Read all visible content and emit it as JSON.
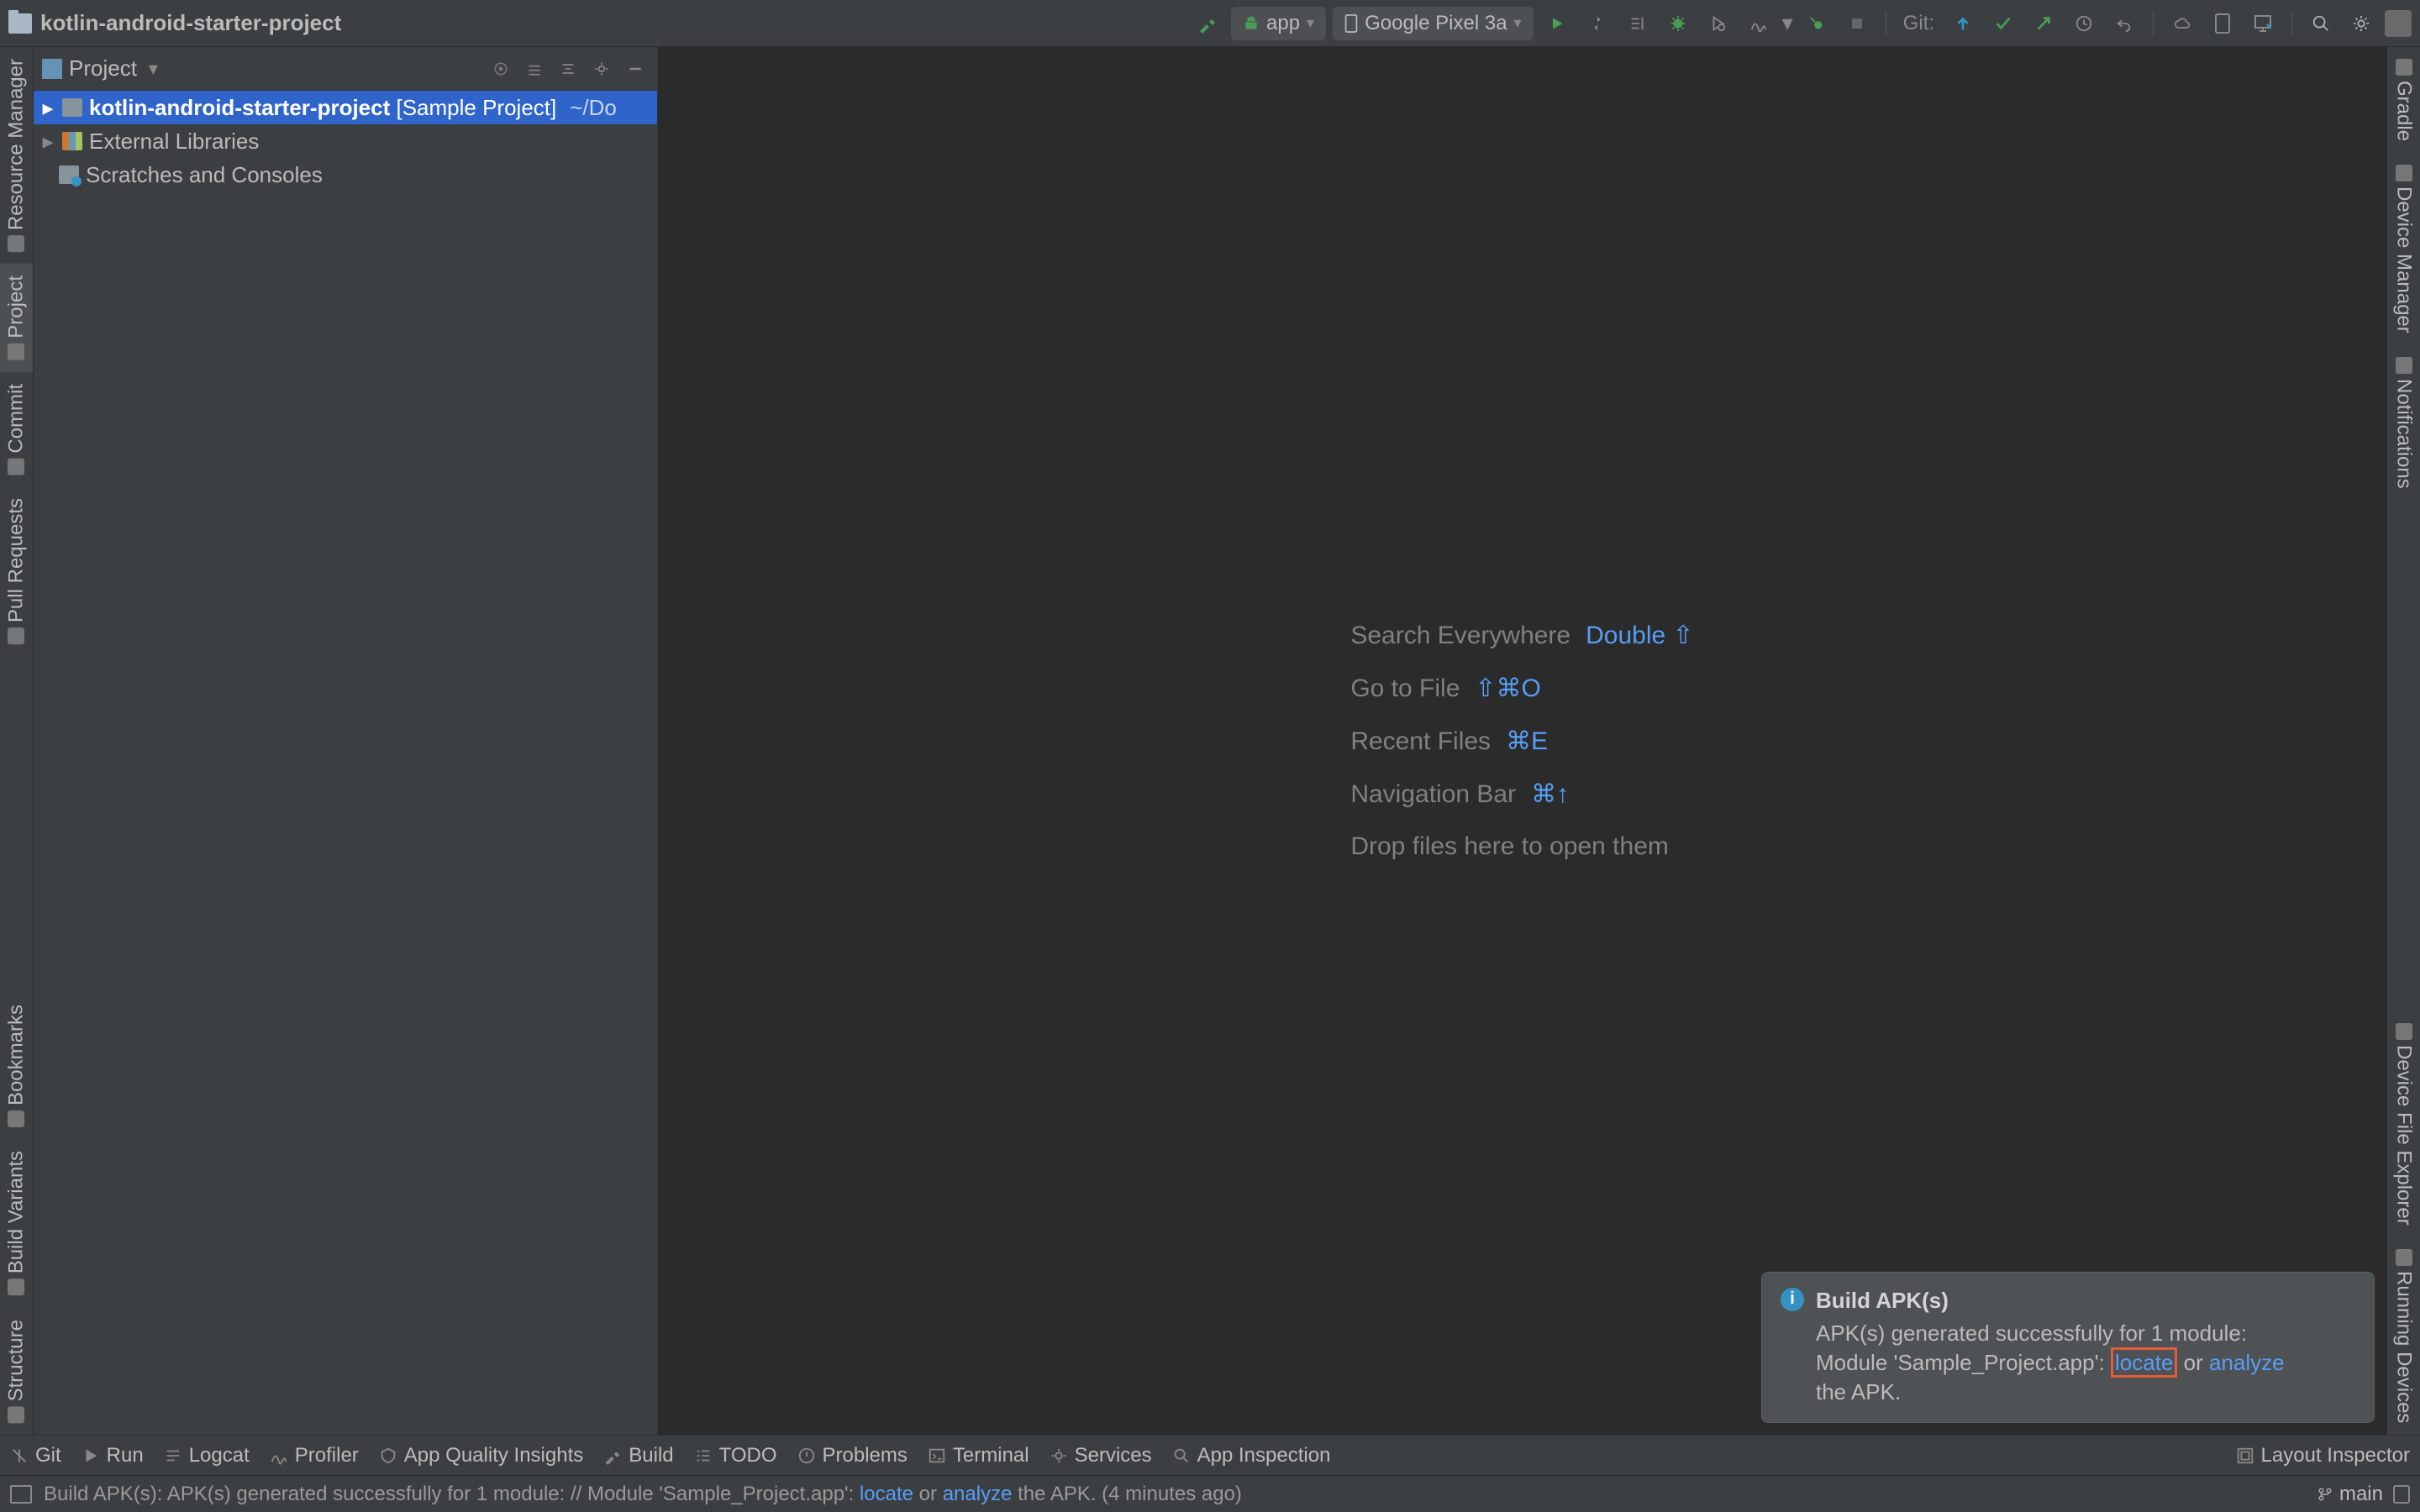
{
  "top": {
    "project_name": "kotlin-android-starter-project",
    "run_config": "app",
    "device": "Google Pixel 3a",
    "git_label": "Git:"
  },
  "project_panel": {
    "selector_label": "Project",
    "tree": {
      "root_name": "kotlin-android-starter-project",
      "root_suffix": "[Sample Project]",
      "root_path": "~/Do",
      "external_libs": "External Libraries",
      "scratches": "Scratches and Consoles"
    }
  },
  "left_gutter": {
    "resource_manager": "Resource Manager",
    "project": "Project",
    "commit": "Commit",
    "pull_requests": "Pull Requests",
    "bookmarks": "Bookmarks",
    "build_variants": "Build Variants",
    "structure": "Structure"
  },
  "right_gutter": {
    "gradle": "Gradle",
    "device_manager": "Device Manager",
    "notifications": "Notifications",
    "device_file_explorer": "Device File Explorer",
    "layout_inspector": "Layout Inspector",
    "running_devices": "Running Devices"
  },
  "editor_shortcuts": {
    "search_everywhere": "Search Everywhere",
    "search_everywhere_key": "Double ⇧",
    "go_to_file": "Go to File",
    "go_to_file_key": "⇧⌘O",
    "recent_files": "Recent Files",
    "recent_files_key": "⌘E",
    "navigation_bar": "Navigation Bar",
    "navigation_bar_key": "⌘↑",
    "drop_hint": "Drop files here to open them"
  },
  "notification": {
    "title": "Build APK(s)",
    "line1": "APK(s) generated successfully for 1 module:",
    "line2_pre": "Module 'Sample_Project.app': ",
    "locate": "locate",
    "or": " or ",
    "analyze": "analyze",
    "line3": "the APK."
  },
  "bottom_strip": {
    "git": "Git",
    "run": "Run",
    "logcat": "Logcat",
    "profiler": "Profiler",
    "aqi": "App Quality Insights",
    "build": "Build",
    "todo": "TODO",
    "problems": "Problems",
    "terminal": "Terminal",
    "services": "Services",
    "app_inspection": "App Inspection",
    "layout_inspector": "Layout Inspector"
  },
  "status_bar": {
    "text_pre": "Build APK(s): APK(s) generated successfully for 1 module: // Module 'Sample_Project.app': ",
    "locate": "locate",
    "or": " or ",
    "analyze": "analyze",
    "text_post": " the APK. (4 minutes ago)",
    "branch": "main"
  }
}
